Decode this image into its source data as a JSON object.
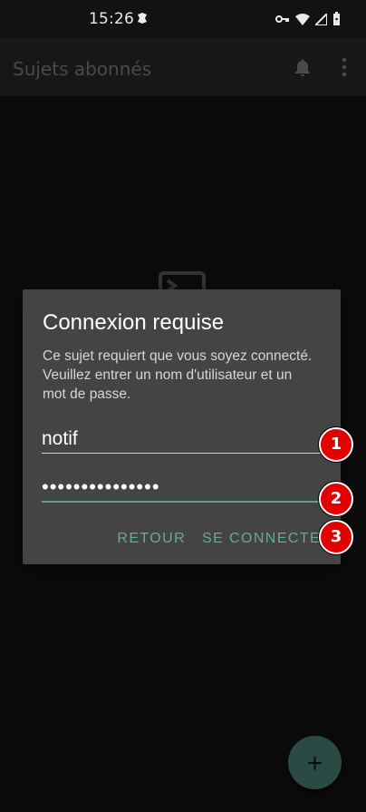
{
  "status_bar": {
    "time": "15:26"
  },
  "app_bar": {
    "title": "Sujets abonnés",
    "icons": [
      "bell-icon",
      "more-vert-icon"
    ]
  },
  "dialog": {
    "title": "Connexion requise",
    "message": "Ce sujet requiert que vous soyez connecté. Veuillez entrer un nom d'utilisateur et un mot de passe.",
    "username_value": "notif",
    "password_value": "•••••••••••••••",
    "buttons": {
      "back": "RETOUR",
      "login": "SE CONNECTER"
    }
  },
  "markers": [
    "1",
    "2",
    "3"
  ],
  "fab": {
    "icon": "add-icon",
    "label": "+"
  },
  "colors": {
    "accent": "#6aa89a",
    "dialog_bg": "#444444",
    "marker": "#e20000"
  }
}
